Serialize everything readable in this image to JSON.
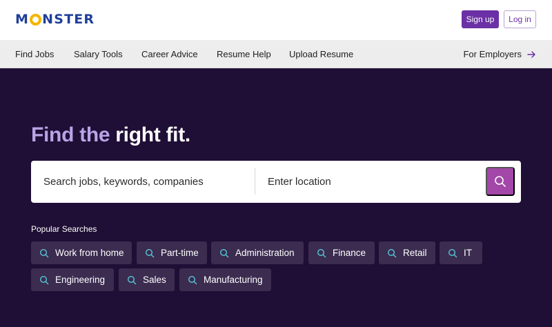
{
  "header": {
    "logo_text_1": "M",
    "logo_text_2": "NSTER",
    "signup_label": "Sign up",
    "login_label": "Log in"
  },
  "nav": {
    "items": [
      "Find Jobs",
      "Salary Tools",
      "Career Advice",
      "Resume Help",
      "Upload Resume"
    ],
    "employers_label": "For Employers"
  },
  "hero": {
    "headline_light": "Find the ",
    "headline_bold": "right fit.",
    "search_placeholder": "Search jobs, keywords, companies",
    "location_placeholder": "Enter location",
    "popular_label": "Popular Searches",
    "chips": [
      "Work from home",
      "Part-time",
      "Administration",
      "Finance",
      "Retail",
      "IT",
      "Engineering",
      "Sales",
      "Manufacturing"
    ]
  },
  "colors": {
    "brand_blue": "#1f3f99",
    "logo_yellow": "#f2b600",
    "accent_purple": "#6b30a5",
    "search_button": "#a347a8",
    "hero_bg": "#1f0e35",
    "chip_bg": "#3b2c50",
    "chip_icon": "#55c8d8"
  },
  "icons": {
    "search": "search-icon",
    "arrow": "arrow-right-icon"
  }
}
